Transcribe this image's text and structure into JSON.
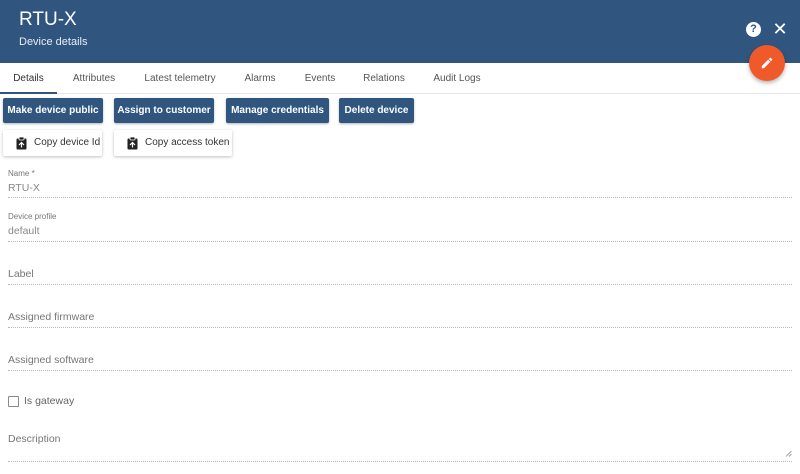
{
  "header": {
    "title": "RTU-X",
    "subtitle": "Device details",
    "help_label": "?",
    "close_label": "✕"
  },
  "tabs": [
    {
      "label": "Details",
      "active": true
    },
    {
      "label": "Attributes",
      "active": false
    },
    {
      "label": "Latest telemetry",
      "active": false
    },
    {
      "label": "Alarms",
      "active": false
    },
    {
      "label": "Events",
      "active": false
    },
    {
      "label": "Relations",
      "active": false
    },
    {
      "label": "Audit Logs",
      "active": false
    }
  ],
  "actions": {
    "make_public": "Make device public",
    "assign_customer": "Assign to customer",
    "manage_credentials": "Manage credentials",
    "delete_device": "Delete device",
    "copy_device_id": "Copy device Id",
    "copy_access_token": "Copy access token"
  },
  "form": {
    "name": {
      "label": "Name *",
      "value": "RTU-X"
    },
    "device_profile": {
      "label": "Device profile",
      "value": "default"
    },
    "label": {
      "placeholder": "Label"
    },
    "assigned_firmware": {
      "placeholder": "Assigned firmware"
    },
    "assigned_software": {
      "placeholder": "Assigned software"
    },
    "is_gateway": {
      "label": "Is gateway",
      "checked": false
    },
    "description": {
      "placeholder": "Description"
    }
  },
  "colors": {
    "primary": "#305680",
    "accent": "#f05a2b"
  },
  "icons": {
    "help": "help-icon",
    "close": "close-icon",
    "edit": "pencil-icon",
    "clipboard": "clipboard-icon"
  }
}
